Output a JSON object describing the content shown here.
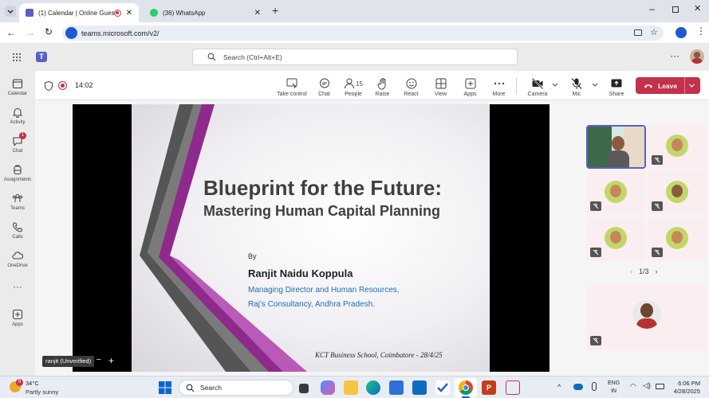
{
  "browser": {
    "tabs": [
      {
        "label": "(1) Calendar | Online Guest",
        "icon": "teams-icon"
      },
      {
        "label": "(36) WhatsApp",
        "icon": "whatsapp-icon"
      }
    ],
    "url": "teams.microsoft.com/v2/"
  },
  "teams": {
    "search_placeholder": "Search (Ctrl+Alt+E)",
    "rail": [
      {
        "label": "Calendar",
        "icon": "calendar-icon"
      },
      {
        "label": "Activity",
        "icon": "bell-icon"
      },
      {
        "label": "Chat",
        "icon": "chat-icon",
        "badge": "1"
      },
      {
        "label": "Assignments",
        "icon": "backpack-icon"
      },
      {
        "label": "Teams",
        "icon": "teams-people-icon"
      },
      {
        "label": "Calls",
        "icon": "phone-icon"
      },
      {
        "label": "OneDrive",
        "icon": "cloud-icon"
      },
      {
        "label": "Apps",
        "icon": "add-app-icon"
      }
    ]
  },
  "meeting": {
    "timer": "14:02",
    "people_count": "15",
    "toolbar": {
      "take_control": "Take control",
      "chat": "Chat",
      "people": "People",
      "raise": "Raise",
      "react": "React",
      "view": "View",
      "apps": "Apps",
      "more": "More",
      "camera": "Camera",
      "mic": "Mic",
      "share": "Share",
      "leave": "Leave"
    },
    "presenter_label": "ranjit (Unverified)",
    "gallery_page": "1/3"
  },
  "slide": {
    "title": "Blueprint for the Future:",
    "subtitle": "Mastering Human Capital Planning",
    "by": "By",
    "author": "Ranjit Naidu Koppula",
    "role_line1": "Managing Director and Human Resources,",
    "role_line2": "Raj's Consultancy, Andhra Pradesh.",
    "footer": "KCT Business School, Coimbatore - 28/4/25"
  },
  "taskbar": {
    "weather_temp": "34°C",
    "weather_desc": "Partly sunny",
    "weather_badge": "9",
    "search": "Search",
    "lang1": "ENG",
    "lang2": "IN",
    "time": "6:06 PM",
    "date": "4/28/2025"
  },
  "colors": {
    "teams_purple": "#5b5fc7",
    "leave_red": "#c4314b",
    "slide_purple": "#8e2a8c"
  }
}
